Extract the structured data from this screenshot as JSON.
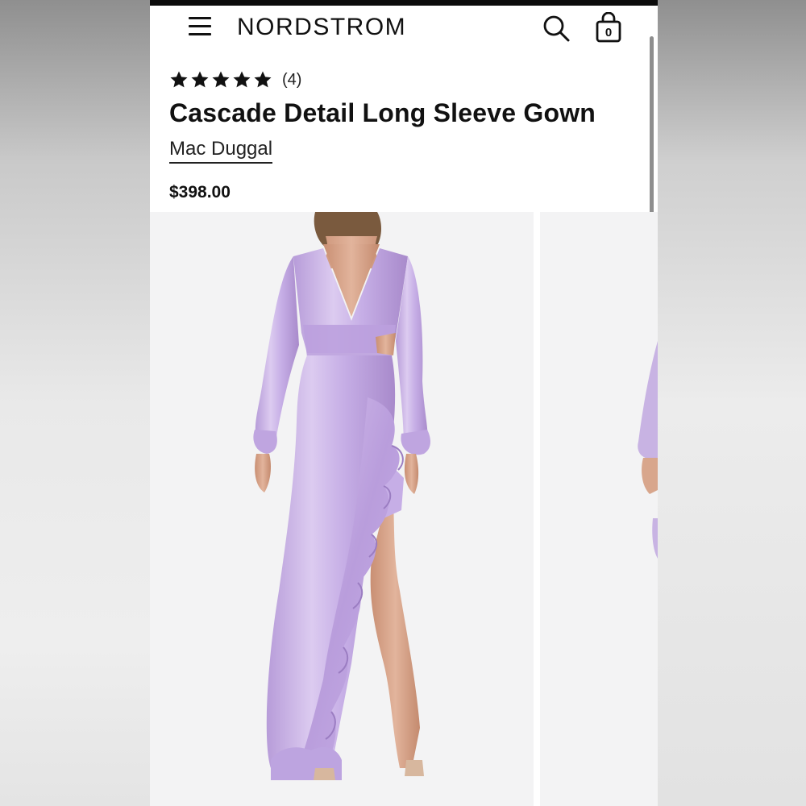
{
  "header": {
    "logo": "NORDSTROM",
    "bag_count": "0"
  },
  "product": {
    "rating": 5,
    "review_count": "(4)",
    "title": "Cascade Detail Long Sleeve Gown",
    "brand": "Mac Duggal",
    "price": "$398.00"
  },
  "icons": {
    "menu": "hamburger-icon",
    "search": "search-icon",
    "bag": "shopping-bag-icon",
    "star": "star-icon"
  },
  "colors": {
    "dress": "#c8b3e3",
    "dress_shadow": "#a98ccc",
    "skin": "#d8a68c",
    "text": "#111111"
  }
}
